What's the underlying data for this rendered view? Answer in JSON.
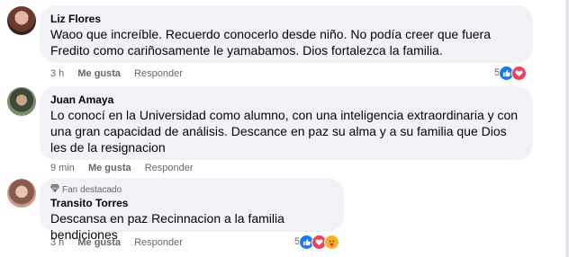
{
  "comments": [
    {
      "author": "Liz Flores",
      "text": "Waoo que increíble. Recuerdo conocerlo desde niño. No podía creer que fuera Fredito como cariñosamente le yamabamos. Dios fortalezca la familia.",
      "time": "3 h",
      "like_label": "Me gusta",
      "reply_label": "Responder",
      "reaction_count": "5",
      "reactions": [
        "like-icon",
        "love-icon"
      ]
    },
    {
      "author": "Juan Amaya",
      "text": "Lo conocí en la Universidad como alumno, con una inteligencia extraordinaria y con una gran capacidad de análisis. Descance en paz su alma y a su familia que Dios les de la resignacion",
      "time": "9 min",
      "like_label": "Me gusta",
      "reply_label": "Responder"
    },
    {
      "badge": "Fan destacado",
      "author": "Transito Torres",
      "text": "Descansa en paz Recinnacion a la familia bendiciones",
      "time": "3 h",
      "like_label": "Me gusta",
      "reply_label": "Responder",
      "reaction_count": "5",
      "reactions": [
        "like-icon",
        "love-icon",
        "care-icon"
      ]
    }
  ],
  "colors": {
    "bubble": "#f0f2f5",
    "meta_text": "#65676b",
    "like": "#1877f2",
    "love": "#f33e58",
    "care": "#f7b125"
  }
}
